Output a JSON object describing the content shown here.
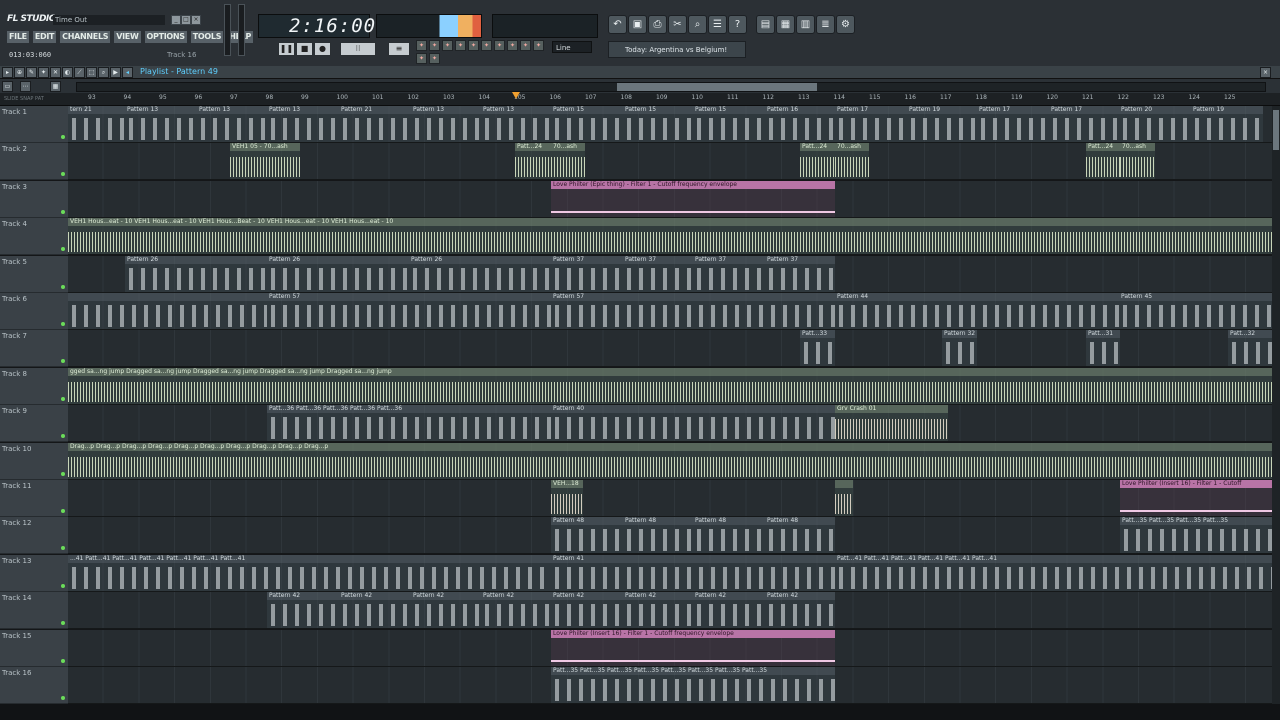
{
  "app": {
    "logo": "FL STUDIO",
    "hint_text": "Time Out",
    "position": "013:03:060",
    "track_indicator": "Track 16"
  },
  "menu": [
    "FILE",
    "EDIT",
    "CHANNELS",
    "VIEW",
    "OPTIONS",
    "TOOLS",
    "HELP"
  ],
  "transport": {
    "time": "2:16:00",
    "snap": "Line"
  },
  "news": "Today: Argentina vs Belgium!",
  "playlist": {
    "title": "Playlist - Pattern 49"
  },
  "ruler": [
    "93",
    "94",
    "95",
    "96",
    "97",
    "98",
    "99",
    "100",
    "101",
    "102",
    "103",
    "104",
    "105",
    "106",
    "107",
    "108",
    "109",
    "110",
    "111",
    "112",
    "113",
    "114",
    "115",
    "116",
    "117",
    "118",
    "119",
    "120",
    "121",
    "122",
    "123",
    "124",
    "125"
  ],
  "snap_labels": [
    "SLIDE",
    "SNAP",
    "PAT"
  ],
  "tracks": [
    {
      "name": "Track 1",
      "clips": [
        {
          "l": 68,
          "w": 57,
          "t": "pat",
          "label": "tern 21"
        },
        {
          "l": 125,
          "w": 72,
          "t": "pat",
          "label": "Pattern 13"
        },
        {
          "l": 197,
          "w": 70,
          "t": "pat",
          "label": "Pattern 13"
        },
        {
          "l": 267,
          "w": 72,
          "t": "pat",
          "label": "Pattern 13"
        },
        {
          "l": 339,
          "w": 72,
          "t": "pat",
          "label": "Pattern 21"
        },
        {
          "l": 411,
          "w": 70,
          "t": "pat",
          "label": "Pattern 13"
        },
        {
          "l": 481,
          "w": 70,
          "t": "pat",
          "label": "Pattern 13"
        },
        {
          "l": 551,
          "w": 72,
          "t": "pat",
          "label": "Pattern 15"
        },
        {
          "l": 623,
          "w": 70,
          "t": "pat",
          "label": "Pattern 15"
        },
        {
          "l": 693,
          "w": 72,
          "t": "pat",
          "label": "Pattern 15"
        },
        {
          "l": 765,
          "w": 70,
          "t": "pat",
          "label": "Pattern 16"
        },
        {
          "l": 835,
          "w": 72,
          "t": "pat",
          "label": "Pattern 17"
        },
        {
          "l": 907,
          "w": 70,
          "t": "pat",
          "label": "Pattern 19"
        },
        {
          "l": 977,
          "w": 72,
          "t": "pat",
          "label": "Pattern 17"
        },
        {
          "l": 1049,
          "w": 70,
          "t": "pat",
          "label": "Pattern 17"
        },
        {
          "l": 1119,
          "w": 72,
          "t": "pat",
          "label": "Pattern 20"
        },
        {
          "l": 1191,
          "w": 72,
          "t": "pat",
          "label": "Pattern 19"
        }
      ]
    },
    {
      "name": "Track 2",
      "clips": [
        {
          "l": 230,
          "w": 70,
          "t": "aud",
          "label": "VEH1 05 - 70...ash"
        },
        {
          "l": 515,
          "w": 36,
          "t": "aud",
          "label": "Patt...24"
        },
        {
          "l": 551,
          "w": 34,
          "t": "aud",
          "label": "70...ash"
        },
        {
          "l": 800,
          "w": 35,
          "t": "aud",
          "label": "Patt...24"
        },
        {
          "l": 835,
          "w": 34,
          "t": "aud",
          "label": "70...ash"
        },
        {
          "l": 1086,
          "w": 34,
          "t": "aud",
          "label": "Patt...24"
        },
        {
          "l": 1120,
          "w": 35,
          "t": "aud",
          "label": "70...ash"
        }
      ]
    },
    {
      "name": "Track 3",
      "clips": [
        {
          "l": 551,
          "w": 284,
          "t": "auto",
          "label": "Love Philter (Epic thing) - Filter 1 - Cutoff frequency envelope"
        }
      ]
    },
    {
      "name": "Track 4",
      "clips": [
        {
          "l": 68,
          "w": 1204,
          "t": "aud",
          "label": "VEH1 Hous...eat - 10  VEH1 Hous...eat - 10  VEH1 Hous...Beat - 10  VEH1 Hous...eat - 10  VEH1 Hous...eat - 10"
        }
      ]
    },
    {
      "name": "Track 5",
      "clips": [
        {
          "l": 125,
          "w": 142,
          "t": "pat",
          "label": "Pattern 26"
        },
        {
          "l": 267,
          "w": 142,
          "t": "pat",
          "label": "Pattern 26"
        },
        {
          "l": 409,
          "w": 142,
          "t": "pat",
          "label": "Pattern 26"
        },
        {
          "l": 551,
          "w": 72,
          "t": "pat",
          "label": "Pattern 37"
        },
        {
          "l": 623,
          "w": 70,
          "t": "pat",
          "label": "Pattern 37"
        },
        {
          "l": 693,
          "w": 72,
          "t": "pat",
          "label": "Pattern 37"
        },
        {
          "l": 765,
          "w": 70,
          "t": "pat",
          "label": "Pattern 37"
        }
      ]
    },
    {
      "name": "Track 6",
      "clips": [
        {
          "l": 68,
          "w": 199,
          "t": "pat",
          "label": ""
        },
        {
          "l": 267,
          "w": 284,
          "t": "pat",
          "label": "Pattern 57"
        },
        {
          "l": 551,
          "w": 284,
          "t": "pat",
          "label": "Pattern 57"
        },
        {
          "l": 835,
          "w": 284,
          "t": "pat",
          "label": "Pattern 44"
        },
        {
          "l": 1119,
          "w": 153,
          "t": "pat",
          "label": "Pattern 45"
        }
      ]
    },
    {
      "name": "Track 7",
      "clips": [
        {
          "l": 800,
          "w": 35,
          "t": "pat",
          "label": "Patt...33"
        },
        {
          "l": 942,
          "w": 35,
          "t": "pat",
          "label": "Pattern 32"
        },
        {
          "l": 1086,
          "w": 34,
          "t": "pat",
          "label": "Patt...31"
        },
        {
          "l": 1228,
          "w": 44,
          "t": "pat",
          "label": "Patt...32"
        }
      ]
    },
    {
      "name": "Track 8",
      "clips": [
        {
          "l": 68,
          "w": 1204,
          "t": "aud",
          "label": "gged sa...ng jump  Dragged sa...ng jump  Dragged sa...ng jump  Dragged sa...ng jump  Dragged sa...ng jump"
        }
      ]
    },
    {
      "name": "Track 9",
      "clips": [
        {
          "l": 267,
          "w": 284,
          "t": "pat",
          "label": "Patt...36  Patt...36  Patt...36  Patt...36  Patt...36"
        },
        {
          "l": 551,
          "w": 284,
          "t": "pat",
          "label": "Pattern 40"
        },
        {
          "l": 835,
          "w": 113,
          "t": "aud",
          "label": "Grv Crash 01"
        }
      ]
    },
    {
      "name": "Track 10",
      "clips": [
        {
          "l": 68,
          "w": 1204,
          "t": "aud",
          "label": "Drag...p  Drag...p  Drag...p  Drag...p  Drag...p  Drag...p  Drag...p  Drag...p  Drag...p  Drag...p"
        }
      ]
    },
    {
      "name": "Track 11",
      "clips": [
        {
          "l": 551,
          "w": 32,
          "t": "aud",
          "label": "VEH...18"
        },
        {
          "l": 835,
          "w": 18,
          "t": "aud",
          "label": ""
        },
        {
          "l": 1120,
          "w": 152,
          "t": "auto",
          "label": "Love Philter (Insert 16) - Filter 1 - Cutoff"
        }
      ]
    },
    {
      "name": "Track 12",
      "clips": [
        {
          "l": 551,
          "w": 72,
          "t": "pat",
          "label": "Pattern 48"
        },
        {
          "l": 623,
          "w": 70,
          "t": "pat",
          "label": "Pattern 48"
        },
        {
          "l": 693,
          "w": 72,
          "t": "pat",
          "label": "Pattern 48"
        },
        {
          "l": 765,
          "w": 70,
          "t": "pat",
          "label": "Pattern 48"
        },
        {
          "l": 1120,
          "w": 152,
          "t": "pat",
          "label": "Patt...35  Patt...35  Patt...35  Patt...35"
        }
      ]
    },
    {
      "name": "Track 13",
      "clips": [
        {
          "l": 68,
          "w": 483,
          "t": "pat",
          "label": "...41  Patt...41  Patt...41  Patt...41  Patt...41  Patt...41  Patt...41"
        },
        {
          "l": 551,
          "w": 284,
          "t": "pat",
          "label": "Pattern 41"
        },
        {
          "l": 835,
          "w": 437,
          "t": "pat",
          "label": "Patt...41  Patt...41  Patt...41  Patt...41  Patt...41  Patt...41"
        }
      ]
    },
    {
      "name": "Track 14",
      "clips": [
        {
          "l": 267,
          "w": 72,
          "t": "pat",
          "label": "Pattern 42"
        },
        {
          "l": 339,
          "w": 72,
          "t": "pat",
          "label": "Pattern 42"
        },
        {
          "l": 411,
          "w": 70,
          "t": "pat",
          "label": "Pattern 42"
        },
        {
          "l": 481,
          "w": 70,
          "t": "pat",
          "label": "Pattern 42"
        },
        {
          "l": 551,
          "w": 72,
          "t": "pat",
          "label": "Pattern 42"
        },
        {
          "l": 623,
          "w": 70,
          "t": "pat",
          "label": "Pattern 42"
        },
        {
          "l": 693,
          "w": 72,
          "t": "pat",
          "label": "Pattern 42"
        },
        {
          "l": 765,
          "w": 70,
          "t": "pat",
          "label": "Pattern 42"
        }
      ]
    },
    {
      "name": "Track 15",
      "clips": [
        {
          "l": 551,
          "w": 284,
          "t": "auto",
          "label": "Love Philter (Insert 16) - Filter 1 - Cutoff frequency envelope"
        }
      ]
    },
    {
      "name": "Track 16",
      "clips": [
        {
          "l": 551,
          "w": 284,
          "t": "pat",
          "label": "Patt...35  Patt...35  Patt...35  Patt...35  Patt...35  Patt...35  Patt...35  Patt...35"
        }
      ]
    }
  ],
  "colors": {
    "accent": "#5fd0ff",
    "automation": "#b874a6",
    "waveform": "#efe6d5",
    "led": "#6bdc5a",
    "playhead": "#f0a030"
  }
}
